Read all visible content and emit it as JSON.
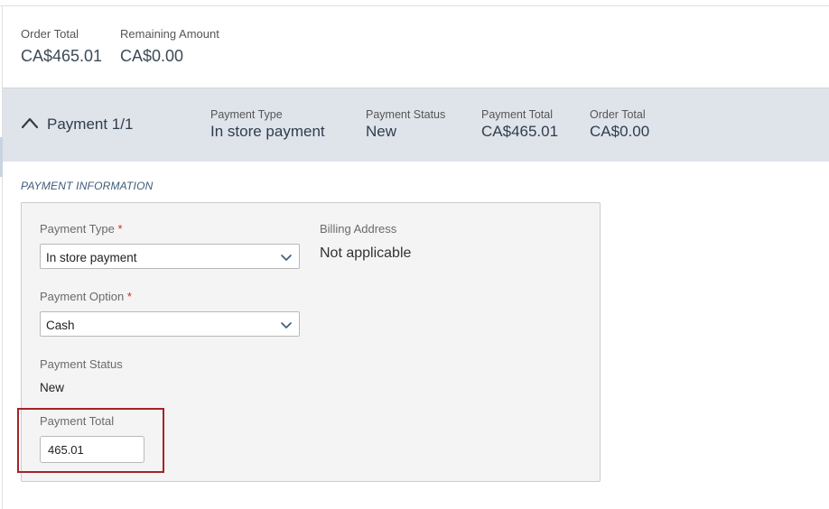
{
  "order_summary": {
    "order_total_label": "Order Total",
    "order_total_value": "CA$465.01",
    "remaining_amount_label": "Remaining Amount",
    "remaining_amount_value": "CA$0.00"
  },
  "payment_bar": {
    "title": "Payment 1/1",
    "payment_type_label": "Payment Type",
    "payment_type_value": "In store payment",
    "payment_status_label": "Payment Status",
    "payment_status_value": "New",
    "payment_total_label": "Payment Total",
    "payment_total_value": "CA$465.01",
    "order_total_label": "Order Total",
    "order_total_value": "CA$0.00",
    "collapse_icon": "chevron-up-icon"
  },
  "payment_information": {
    "section_title": "PAYMENT INFORMATION",
    "payment_type_label": "Payment Type",
    "payment_type_value": "In store payment",
    "payment_option_label": "Payment Option",
    "payment_option_value": "Cash",
    "required_marker": "*",
    "payment_status_label": "Payment Status",
    "payment_status_value": "New",
    "payment_total_label": "Payment Total",
    "payment_total_value": "465.01",
    "billing_address_label": "Billing Address",
    "billing_address_value": "Not applicable",
    "dropdown_icon": "chevron-down-icon"
  },
  "colors": {
    "payment_bar_bg": "#dfe4eb",
    "heading_text": "#2f3d4b",
    "required": "#d9262b",
    "highlight": "#a3232a",
    "section_title": "#3d5a78"
  }
}
